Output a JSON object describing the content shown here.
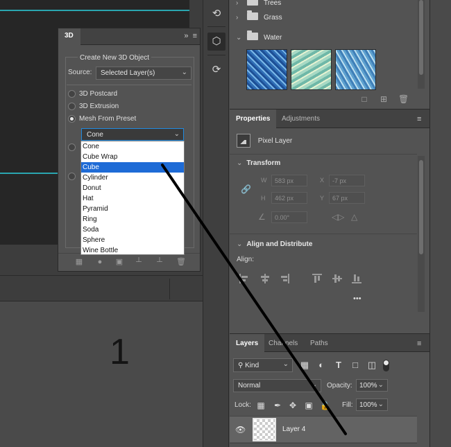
{
  "annotation_label": "1",
  "panel_3d": {
    "tab": "3D",
    "group_title": "Create New 3D Object",
    "source_label": "Source:",
    "source_value": "Selected Layer(s)",
    "options": [
      "3D Postcard",
      "3D Extrusion",
      "Mesh From Preset"
    ],
    "selected_option": "Mesh From Preset",
    "preset_value": "Cone",
    "preset_list": [
      "Cone",
      "Cube Wrap",
      "Cube",
      "Cylinder",
      "Donut",
      "Hat",
      "Pyramid",
      "Ring",
      "Soda",
      "Sphere",
      "Wine Bottle"
    ],
    "highlighted_preset": "Cube"
  },
  "swatches": {
    "folders": [
      "Trees",
      "Grass",
      "Water"
    ],
    "expanded_folder": "Water"
  },
  "properties": {
    "tabs": [
      "Properties",
      "Adjustments"
    ],
    "layer_type": "Pixel Layer",
    "transform_title": "Transform",
    "w_label": "W",
    "w_value": "583 px",
    "h_label": "H",
    "h_value": "462 px",
    "x_label": "X",
    "x_value": "-7 px",
    "y_label": "Y",
    "y_value": "67 px",
    "angle_value": "0.00°",
    "align_title": "Align and Distribute",
    "align_label": "Align:",
    "more_label": "•••"
  },
  "layers": {
    "tabs": [
      "Layers",
      "Channels",
      "Paths"
    ],
    "filter_kind": "Kind",
    "blend_mode": "Normal",
    "opacity_label": "Opacity:",
    "opacity_value": "100%",
    "lock_label": "Lock:",
    "fill_label": "Fill:",
    "fill_value": "100%",
    "layer_name": "Layer 4"
  },
  "colors": {
    "panel_bg": "#535353",
    "dark_bg": "#262626",
    "guide_cyan": "#2aa6b0",
    "selection_blue": "#1e6bd6"
  }
}
